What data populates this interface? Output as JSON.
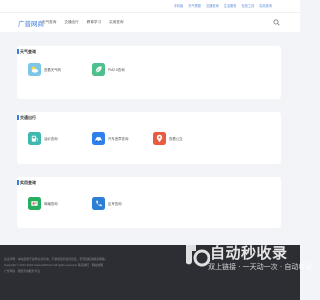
{
  "topbar": {
    "links": [
      "手机版",
      "天气预报",
      "交通查询",
      "生活服务",
      "在线工具",
      "实用查询"
    ]
  },
  "header": {
    "logo": "广普网商",
    "nav": [
      "天气查询",
      "交通出行",
      "教育学习",
      "实用查询"
    ],
    "search_icon": "search-icon"
  },
  "sections": [
    {
      "title": "天气查询",
      "items": [
        {
          "label": "查看天气网",
          "icon": "sun-cloud-icon",
          "color": "#7cc7e8"
        },
        {
          "label": "PM2.5查询",
          "icon": "leaf-icon",
          "color": "#4fc08d"
        }
      ]
    },
    {
      "title": "交通出行",
      "items": [
        {
          "label": "油价查询",
          "icon": "fuel-icon",
          "color": "#3fb8ae"
        },
        {
          "label": "汽车违章查询",
          "icon": "car-icon",
          "color": "#2f80ed"
        },
        {
          "label": "查看公交",
          "icon": "location-pin-icon",
          "color": "#e85c41"
        }
      ]
    },
    {
      "title": "实用查询",
      "items": [
        {
          "label": "邮编查询",
          "icon": "mail-icon",
          "color": "#27ae60"
        },
        {
          "label": "区号查询",
          "icon": "phone-icon",
          "color": "#2d7fd3"
        }
      ]
    }
  ],
  "footer": {
    "line1": "免责声明：本站仅用于提供信息查询，不承担任何法律责任，若有侵权请联系删除。",
    "line2": "Copyright © 2012-2024 chaxun100.com All rights reserved. 联系我们 · 网站地图",
    "line3": "广普网商 · 便民查询服务平台"
  },
  "watermark": {
    "main": "自动秒收录",
    "sub": "双上链接 · 一天动一次 · 自动收录"
  }
}
